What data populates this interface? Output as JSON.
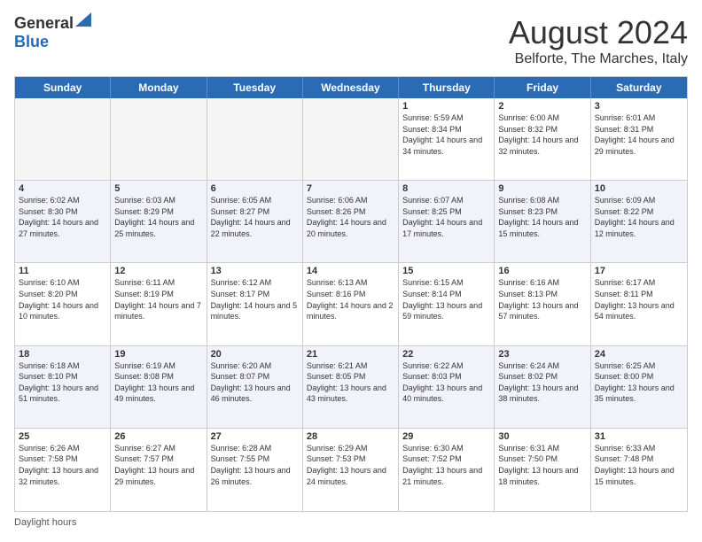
{
  "logo": {
    "general": "General",
    "blue": "Blue"
  },
  "title": {
    "month": "August 2024",
    "location": "Belforte, The Marches, Italy"
  },
  "header_days": [
    "Sunday",
    "Monday",
    "Tuesday",
    "Wednesday",
    "Thursday",
    "Friday",
    "Saturday"
  ],
  "footer": {
    "label": "Daylight hours"
  },
  "weeks": [
    [
      {
        "day": "",
        "info": "",
        "empty": true
      },
      {
        "day": "",
        "info": "",
        "empty": true
      },
      {
        "day": "",
        "info": "",
        "empty": true
      },
      {
        "day": "",
        "info": "",
        "empty": true
      },
      {
        "day": "1",
        "info": "Sunrise: 5:59 AM\nSunset: 8:34 PM\nDaylight: 14 hours and 34 minutes.",
        "empty": false
      },
      {
        "day": "2",
        "info": "Sunrise: 6:00 AM\nSunset: 8:32 PM\nDaylight: 14 hours and 32 minutes.",
        "empty": false
      },
      {
        "day": "3",
        "info": "Sunrise: 6:01 AM\nSunset: 8:31 PM\nDaylight: 14 hours and 29 minutes.",
        "empty": false
      }
    ],
    [
      {
        "day": "4",
        "info": "Sunrise: 6:02 AM\nSunset: 8:30 PM\nDaylight: 14 hours and 27 minutes.",
        "empty": false
      },
      {
        "day": "5",
        "info": "Sunrise: 6:03 AM\nSunset: 8:29 PM\nDaylight: 14 hours and 25 minutes.",
        "empty": false
      },
      {
        "day": "6",
        "info": "Sunrise: 6:05 AM\nSunset: 8:27 PM\nDaylight: 14 hours and 22 minutes.",
        "empty": false
      },
      {
        "day": "7",
        "info": "Sunrise: 6:06 AM\nSunset: 8:26 PM\nDaylight: 14 hours and 20 minutes.",
        "empty": false
      },
      {
        "day": "8",
        "info": "Sunrise: 6:07 AM\nSunset: 8:25 PM\nDaylight: 14 hours and 17 minutes.",
        "empty": false
      },
      {
        "day": "9",
        "info": "Sunrise: 6:08 AM\nSunset: 8:23 PM\nDaylight: 14 hours and 15 minutes.",
        "empty": false
      },
      {
        "day": "10",
        "info": "Sunrise: 6:09 AM\nSunset: 8:22 PM\nDaylight: 14 hours and 12 minutes.",
        "empty": false
      }
    ],
    [
      {
        "day": "11",
        "info": "Sunrise: 6:10 AM\nSunset: 8:20 PM\nDaylight: 14 hours and 10 minutes.",
        "empty": false
      },
      {
        "day": "12",
        "info": "Sunrise: 6:11 AM\nSunset: 8:19 PM\nDaylight: 14 hours and 7 minutes.",
        "empty": false
      },
      {
        "day": "13",
        "info": "Sunrise: 6:12 AM\nSunset: 8:17 PM\nDaylight: 14 hours and 5 minutes.",
        "empty": false
      },
      {
        "day": "14",
        "info": "Sunrise: 6:13 AM\nSunset: 8:16 PM\nDaylight: 14 hours and 2 minutes.",
        "empty": false
      },
      {
        "day": "15",
        "info": "Sunrise: 6:15 AM\nSunset: 8:14 PM\nDaylight: 13 hours and 59 minutes.",
        "empty": false
      },
      {
        "day": "16",
        "info": "Sunrise: 6:16 AM\nSunset: 8:13 PM\nDaylight: 13 hours and 57 minutes.",
        "empty": false
      },
      {
        "day": "17",
        "info": "Sunrise: 6:17 AM\nSunset: 8:11 PM\nDaylight: 13 hours and 54 minutes.",
        "empty": false
      }
    ],
    [
      {
        "day": "18",
        "info": "Sunrise: 6:18 AM\nSunset: 8:10 PM\nDaylight: 13 hours and 51 minutes.",
        "empty": false
      },
      {
        "day": "19",
        "info": "Sunrise: 6:19 AM\nSunset: 8:08 PM\nDaylight: 13 hours and 49 minutes.",
        "empty": false
      },
      {
        "day": "20",
        "info": "Sunrise: 6:20 AM\nSunset: 8:07 PM\nDaylight: 13 hours and 46 minutes.",
        "empty": false
      },
      {
        "day": "21",
        "info": "Sunrise: 6:21 AM\nSunset: 8:05 PM\nDaylight: 13 hours and 43 minutes.",
        "empty": false
      },
      {
        "day": "22",
        "info": "Sunrise: 6:22 AM\nSunset: 8:03 PM\nDaylight: 13 hours and 40 minutes.",
        "empty": false
      },
      {
        "day": "23",
        "info": "Sunrise: 6:24 AM\nSunset: 8:02 PM\nDaylight: 13 hours and 38 minutes.",
        "empty": false
      },
      {
        "day": "24",
        "info": "Sunrise: 6:25 AM\nSunset: 8:00 PM\nDaylight: 13 hours and 35 minutes.",
        "empty": false
      }
    ],
    [
      {
        "day": "25",
        "info": "Sunrise: 6:26 AM\nSunset: 7:58 PM\nDaylight: 13 hours and 32 minutes.",
        "empty": false
      },
      {
        "day": "26",
        "info": "Sunrise: 6:27 AM\nSunset: 7:57 PM\nDaylight: 13 hours and 29 minutes.",
        "empty": false
      },
      {
        "day": "27",
        "info": "Sunrise: 6:28 AM\nSunset: 7:55 PM\nDaylight: 13 hours and 26 minutes.",
        "empty": false
      },
      {
        "day": "28",
        "info": "Sunrise: 6:29 AM\nSunset: 7:53 PM\nDaylight: 13 hours and 24 minutes.",
        "empty": false
      },
      {
        "day": "29",
        "info": "Sunrise: 6:30 AM\nSunset: 7:52 PM\nDaylight: 13 hours and 21 minutes.",
        "empty": false
      },
      {
        "day": "30",
        "info": "Sunrise: 6:31 AM\nSunset: 7:50 PM\nDaylight: 13 hours and 18 minutes.",
        "empty": false
      },
      {
        "day": "31",
        "info": "Sunrise: 6:33 AM\nSunset: 7:48 PM\nDaylight: 13 hours and 15 minutes.",
        "empty": false
      }
    ]
  ]
}
